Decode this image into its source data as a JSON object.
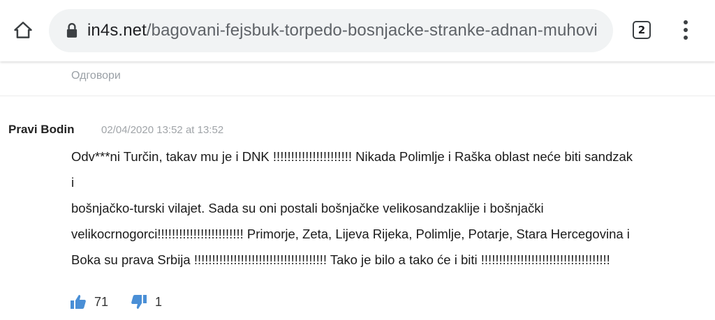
{
  "browser": {
    "url_host": "in4s.net",
    "url_path": "/bagovani-fejsbuk-torpedo-bosnjacke-stranke-adnan-muhovi",
    "tab_count": "2",
    "icons": [
      "home-icon",
      "lock-icon",
      "tabs-icon",
      "more-vert-icon"
    ]
  },
  "previous": {
    "reply_label": "Одговори"
  },
  "comment": {
    "author": "Pravi Bodin",
    "timestamp": "02/04/2020 13:52 at 13:52",
    "lines": [
      "Odv***ni Turčin, takav mu je i DNK !!!!!!!!!!!!!!!!!!!!!! Nikada Polimlje i Raška oblast neće biti sandzak",
      "i",
      "bošnjačko-turski vilajet. Sada su oni postali bošnjačke velikosandzaklije i bošnjački",
      "velikocrnogorci!!!!!!!!!!!!!!!!!!!!!!!! Primorje, Zeta, Lijeva Rijeka, Polimlje, Potarje, Stara Hercegovina i",
      "Boka su prava Srbija !!!!!!!!!!!!!!!!!!!!!!!!!!!!!!!!!!!!! Tako je bilo a tako će i biti !!!!!!!!!!!!!!!!!!!!!!!!!!!!!!!!!!!!"
    ],
    "likes": "71",
    "dislikes": "1"
  },
  "colors": {
    "vote_icon": "#4a8fd6",
    "urlbar_bg": "#f1f3f4",
    "muted_text": "#9aa0a6"
  }
}
